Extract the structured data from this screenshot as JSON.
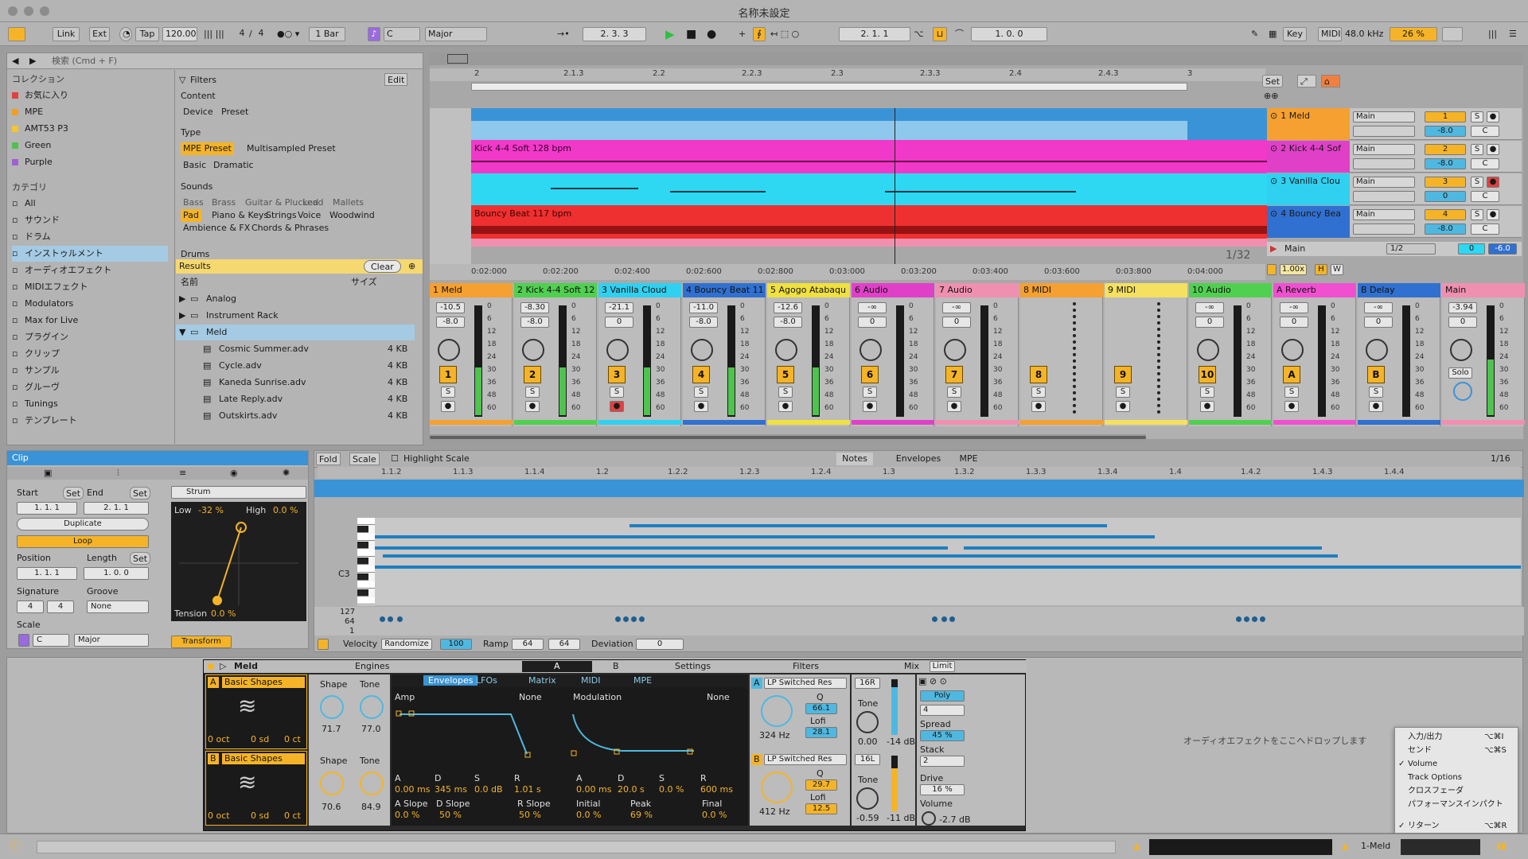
{
  "window": {
    "title": "名称未設定"
  },
  "toolbar": {
    "link": "Link",
    "ext": "Ext",
    "tap": "Tap",
    "tempo": "120.00",
    "signature_num": "4",
    "signature_den": "4",
    "quantize": "1 Bar",
    "key": "C",
    "scale": "Major",
    "position": "2.  3.  3",
    "loop_start": "2.  1.  1",
    "loop_length": "1.  0.  0",
    "key_btn": "Key",
    "midi_btn": "MIDI",
    "sample_rate": "48.0 kHz",
    "cpu": "26 %"
  },
  "browser": {
    "search_placeholder": "検索 (Cmd + F)",
    "collections_title": "コレクション",
    "collections": [
      {
        "label": "お気に入り",
        "color": "#e04040"
      },
      {
        "label": "MPE",
        "color": "#f0a020"
      },
      {
        "label": "AMT53 P3",
        "color": "#f5c430"
      },
      {
        "label": "Green",
        "color": "#50c050"
      },
      {
        "label": "Purple",
        "color": "#a060d0"
      }
    ],
    "categories_title": "カテゴリ",
    "categories": [
      "All",
      "サウンド",
      "ドラム",
      "インストゥルメント",
      "オーディオエフェクト",
      "MIDIエフェクト",
      "Modulators",
      "Max for Live",
      "プラグイン",
      "クリップ",
      "サンプル",
      "グルーヴ",
      "Tunings",
      "テンプレート"
    ],
    "filters_label": "Filters",
    "edit_label": "Edit",
    "content_label": "Content",
    "content_tags": [
      "Device",
      "Preset"
    ],
    "type_label": "Type",
    "type_tags": [
      "MPE Preset",
      "Multisampled Preset",
      "Basic",
      "Dramatic"
    ],
    "sounds_label": "Sounds",
    "sounds_tags": [
      "Bass",
      "Brass",
      "Guitar & Plucked",
      "Lead",
      "Mallets",
      "Pad",
      "Piano & Keys",
      "Strings",
      "Voice",
      "Woodwind",
      "Ambience & FX",
      "Chords & Phrases"
    ],
    "drums_label": "Drums",
    "results_label": "Results",
    "clear_label": "Clear",
    "col_name": "名前",
    "col_size": "サイズ",
    "folders": [
      "Analog",
      "Instrument Rack",
      "Meld"
    ],
    "files": [
      {
        "name": "Cosmic Summer.adv",
        "size": "4 KB"
      },
      {
        "name": "Cycle.adv",
        "size": "4 KB"
      },
      {
        "name": "Kaneda Sunrise.adv",
        "size": "4 KB"
      },
      {
        "name": "Late Reply.adv",
        "size": "4 KB"
      },
      {
        "name": "Outskirts.adv",
        "size": "4 KB"
      }
    ]
  },
  "arrangement": {
    "ruler": [
      "2",
      "2.1.3",
      "2.2",
      "2.2.3",
      "2.3",
      "2.3.3",
      "2.4",
      "2.4.3",
      "3"
    ],
    "time_ruler": [
      "0:02:000",
      "0:02:200",
      "0:02:400",
      "0:02:600",
      "0:02:800",
      "0:03:000",
      "0:03:200",
      "0:03:400",
      "0:03:600",
      "0:03:800",
      "0:04:000"
    ],
    "grid": "1/32",
    "set_label": "Set",
    "clip_kick": "Kick 4-4 Soft 128 bpm",
    "clip_bouncy": "Bouncy Beat 117 bpm",
    "tracks": [
      {
        "name": "1 Meld",
        "color": "#f5a030",
        "out": "Main",
        "num": "1",
        "vol": "-8.0"
      },
      {
        "name": "2 Kick 4-4 Sof",
        "color": "#e040c8",
        "out": "Main",
        "num": "2",
        "vol": "-8.0"
      },
      {
        "name": "3 Vanilla Clou",
        "color": "#30d0f0",
        "out": "Main",
        "num": "3",
        "vol": "0"
      },
      {
        "name": "4 Bouncy Bea",
        "color": "#3070d0",
        "out": "Main",
        "num": "4",
        "vol": "-8.0"
      }
    ],
    "main_track": {
      "name": "Main",
      "out": "1/2",
      "vol": "0",
      "pan": "-6.0"
    },
    "tempo_factor": "1.00x",
    "h": "H",
    "w": "W",
    "c_label": "C",
    "s_label": "S"
  },
  "mixer": {
    "channels": [
      {
        "name": "1 Meld",
        "color": "#f5a030",
        "peak": "-10.5",
        "vol": "-8.0",
        "num": "1"
      },
      {
        "name": "2 Kick 4-4 Soft 12",
        "color": "#50d050",
        "peak": "-8.30",
        "vol": "-8.0",
        "num": "2"
      },
      {
        "name": "3 Vanilla Cloud",
        "color": "#30d0f0",
        "peak": "-21.1",
        "vol": "0",
        "num": "3"
      },
      {
        "name": "4 Bouncy Beat 11",
        "color": "#3070d0",
        "peak": "-11.0",
        "vol": "-8.0",
        "num": "4"
      },
      {
        "name": "5 Agogo Atabaqu",
        "color": "#f0e040",
        "peak": "-12.6",
        "vol": "-8.0",
        "num": "5"
      },
      {
        "name": "6 Audio",
        "color": "#e040c8",
        "peak": "-∞",
        "vol": "0",
        "num": "6"
      },
      {
        "name": "7 Audio",
        "color": "#f090b0",
        "peak": "-∞",
        "vol": "0",
        "num": "7"
      },
      {
        "name": "8 MIDI",
        "color": "#f5a030",
        "peak": "",
        "vol": "",
        "num": "8"
      },
      {
        "name": "9 MIDI",
        "color": "#f5e060",
        "peak": "",
        "vol": "",
        "num": "9"
      },
      {
        "name": "10 Audio",
        "color": "#50d050",
        "peak": "-∞",
        "vol": "0",
        "num": "10"
      },
      {
        "name": "A Reverb",
        "color": "#f050d0",
        "peak": "-∞",
        "vol": "0",
        "num": "A"
      },
      {
        "name": "B Delay",
        "color": "#3070d0",
        "peak": "-∞",
        "vol": "0",
        "num": "B"
      },
      {
        "name": "Main",
        "color": "#f090b0",
        "peak": "-3.94",
        "vol": "0",
        "num": ""
      }
    ],
    "scale": [
      "0",
      "6",
      "12",
      "18",
      "24",
      "30",
      "36",
      "48",
      "60"
    ],
    "solo_label": "Solo",
    "s_label": "S"
  },
  "clip_view": {
    "title": "Clip",
    "start_label": "Start",
    "end_label": "End",
    "set_label": "Set",
    "start": "1.  1.  1",
    "end": "2.  1.  1",
    "duplicate": "Duplicate",
    "loop": "Loop",
    "position_label": "Position",
    "length_label": "Length",
    "position": "1.  1.  1",
    "length": "1.  0.  0",
    "signature_label": "Signature",
    "groove_label": "Groove",
    "sig_num": "4",
    "sig_den": "4",
    "groove": "None",
    "scale_label": "Scale",
    "scale_key": "C",
    "scale_mode": "Major",
    "strum": "Strum",
    "low_label": "Low",
    "low_val": "-32 %",
    "high_label": "High",
    "high_val": "0.0 %",
    "tension_label": "Tension",
    "tension_val": "0.0 %",
    "transform": "Transform",
    "fold": "Fold",
    "scale_btn": "Scale",
    "highlight": "Highlight Scale",
    "tabs": [
      "Notes",
      "Envelopes",
      "MPE"
    ],
    "grid": "1/16",
    "ruler": [
      "1.1.2",
      "1.1.3",
      "1.1.4",
      "1.2",
      "1.2.2",
      "1.2.3",
      "1.2.4",
      "1.3",
      "1.3.2",
      "1.3.3",
      "1.3.4",
      "1.4",
      "1.4.2",
      "1.4.3",
      "1.4.4"
    ],
    "c3": "C3",
    "vel_127": "127",
    "vel_64": "64",
    "vel_1": "1",
    "velocity_label": "Velocity",
    "randomize": "Randomize",
    "vel_value": "100",
    "ramp_label": "Ramp",
    "ramp_a": "64",
    "ramp_b": "64",
    "deviation_label": "Deviation",
    "deviation_val": "0"
  },
  "device": {
    "name": "Meld",
    "engines_label": "Engines",
    "tab_a": "A",
    "tab_b": "B",
    "settings": "Settings",
    "osc_a": "Basic Shapes",
    "osc_b": "Basic Shapes",
    "shape_label": "Shape",
    "tone_label": "Tone",
    "a_shape": "71.7",
    "a_tone": "77.0",
    "b_shape": "70.6",
    "b_tone": "84.9",
    "oct": "0 oct",
    "sd": "0 sd",
    "ct": "0 ct",
    "subtabs": [
      "Envelopes",
      "LFOs",
      "Matrix",
      "MIDI",
      "MPE"
    ],
    "amp_label": "Amp",
    "mod_label": "Modulation",
    "none": "None",
    "adsr_a_labels": [
      "A",
      "D",
      "S",
      "R"
    ],
    "adsr_a_vals": [
      "0.00 ms",
      "345 ms",
      "0.0 dB",
      "1.01 s"
    ],
    "adsr_b_labels": [
      "A",
      "D",
      "S",
      "R"
    ],
    "adsr_b_vals": [
      "0.00 ms",
      "20.0 s",
      "0.0 %",
      "600 ms"
    ],
    "a_slope": "A Slope",
    "a_slope_val": "0.0 %",
    "d_slope": "D Slope",
    "d_slope_val": "50 %",
    "r_slope": "R Slope",
    "r_slope_val": "50 %",
    "initial": "Initial",
    "initial_val": "0.0 %",
    "peak": "Peak",
    "peak_val": "69 %",
    "final": "Final",
    "final_val": "0.0 %",
    "filters_label": "Filters",
    "mix_label": "Mix",
    "limit": "Limit",
    "filter_a": "LP Switched Res",
    "filter_b": "LP Switched Res",
    "freq_a": "324 Hz",
    "freq_b": "412 Hz",
    "q_label": "Q",
    "lofi_label": "Lofi",
    "q_a": "66.1",
    "lofi_a": "28.1",
    "q_b": "29.7",
    "lofi_b": "12.5",
    "pan_a": "16R",
    "pan_b": "16L",
    "tone_a": "0.00",
    "tone_b": "-0.59",
    "gain_a": "-14 dB",
    "gain_b": "-11 dB",
    "poly": "Poly",
    "voices": "4",
    "spread_label": "Spread",
    "spread": "45 %",
    "stack_label": "Stack",
    "stack": "2",
    "drive_label": "Drive",
    "drive": "16 %",
    "volume_label": "Volume",
    "volume": "-2.7 dB"
  },
  "drop_hint": "オーディオエフェクトをここへドロップします",
  "context_menu": [
    {
      "label": "入力/出力",
      "shortcut": "⌥⌘I",
      "checked": false
    },
    {
      "label": "センド",
      "shortcut": "⌥⌘S",
      "checked": false
    },
    {
      "label": "Volume",
      "shortcut": "",
      "checked": true
    },
    {
      "label": "Track Options",
      "shortcut": "",
      "checked": false
    },
    {
      "label": "クロスフェーダ",
      "shortcut": "",
      "checked": false
    },
    {
      "label": "パフォーマンスインパクト",
      "shortcut": "",
      "checked": false
    },
    {
      "label": "リターン",
      "shortcut": "⌥⌘R",
      "checked": true
    }
  ],
  "statusbar": {
    "track": "1-Meld"
  }
}
